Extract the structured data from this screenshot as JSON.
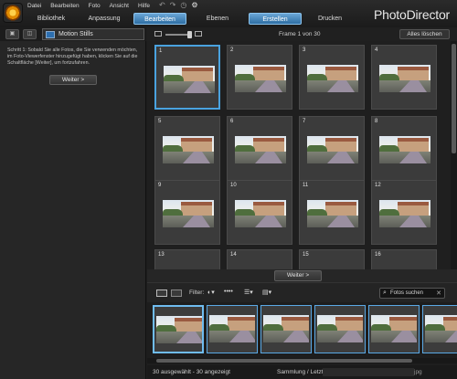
{
  "app": {
    "name": "PhotoDirector"
  },
  "menu": [
    "Datei",
    "Bearbeiten",
    "Foto",
    "Ansicht",
    "Hilfe"
  ],
  "tabs": [
    "Bibliothek",
    "Anpassung",
    "Bearbeiten",
    "Ebenen",
    "Erstellen",
    "Drucken"
  ],
  "active_tabs": [
    "Bearbeiten",
    "Erstellen"
  ],
  "left_panel": {
    "tab_label": "Motion Stills",
    "instructions": "Schritt 1: Sobald Sie alle Fotos, die Sie verwenden möchten, im Foto-Viewerfenster hinzugefügt haben, klicken Sie auf die Schaltfläche [Weiter], um fortzufahren.",
    "next_button": "Weiter  >"
  },
  "toolbar": {
    "frame_label": "Frame  1 von  30",
    "clear_all": "Alles löschen"
  },
  "frames": [
    "1",
    "2",
    "3",
    "4",
    "5",
    "6",
    "7",
    "8",
    "9",
    "10",
    "11",
    "12",
    "13",
    "14",
    "15",
    "16"
  ],
  "next_bar": {
    "label": "Weiter  >"
  },
  "filter": {
    "label": "Filter:",
    "search_placeholder": "Fotos suchen"
  },
  "status": {
    "count": "30 ausgewählt - 30 angezeigt",
    "collection": "Sammlung / Letzte Importe /",
    "ext": "jpg"
  },
  "colors": {
    "accent": "#4aa3e0",
    "panel": "#262626",
    "background": "#1e1e1e"
  }
}
